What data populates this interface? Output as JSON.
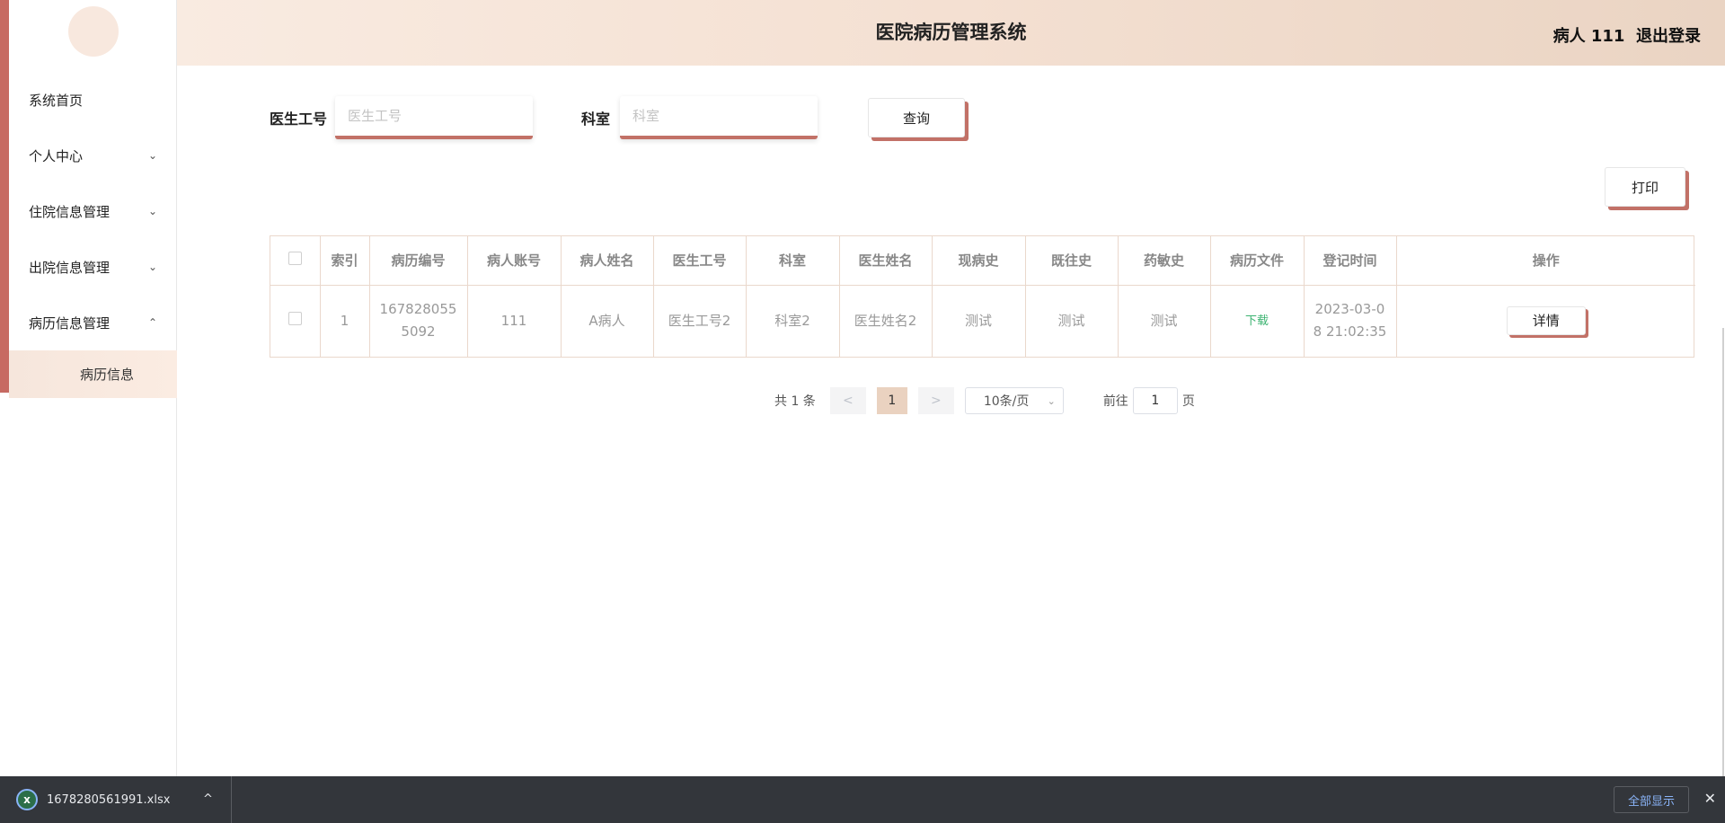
{
  "header": {
    "title": "医院病历管理系统",
    "user_name": "病人 111",
    "logout_label": "退出登录"
  },
  "sidebar": {
    "items": [
      {
        "label": "系统首页",
        "has_chevron": false
      },
      {
        "label": "个人中心",
        "chevron": "⌄"
      },
      {
        "label": "住院信息管理",
        "chevron": "⌄"
      },
      {
        "label": "出院信息管理",
        "chevron": "⌄"
      },
      {
        "label": "病历信息管理",
        "chevron": "⌃"
      }
    ],
    "submenu_label": "病历信息"
  },
  "search": {
    "doctor_id_label": "医生工号",
    "doctor_id_placeholder": "医生工号",
    "department_label": "科室",
    "department_placeholder": "科室",
    "query_label": "查询"
  },
  "toolbar": {
    "print_label": "打印"
  },
  "table": {
    "columns": [
      "索引",
      "病历编号",
      "病人账号",
      "病人姓名",
      "医生工号",
      "科室",
      "医生姓名",
      "现病史",
      "既往史",
      "药敏史",
      "病历文件",
      "登记时间",
      "操作"
    ],
    "rows": [
      {
        "index": "1",
        "record_no_line1": "167828055",
        "record_no_line2": "5092",
        "patient_account": "111",
        "patient_name": "A病人",
        "doctor_id": "医生工号2",
        "department": "科室2",
        "doctor_name": "医生姓名2",
        "present_history": "测试",
        "past_history": "测试",
        "allergy_history": "测试",
        "file_link": "下载",
        "time_line1": "2023-03-0",
        "time_line2": "8 21:02:35",
        "action_label": "详情"
      }
    ]
  },
  "pagination": {
    "total_text": "共 1 条",
    "prev": "<",
    "current_page": "1",
    "next": ">",
    "page_size": "10条/页",
    "goto_label": "前往",
    "goto_value": "1",
    "page_suffix": "页"
  },
  "download_bar": {
    "file_name": "1678280561991.xlsx",
    "show_all_label": "全部显示",
    "close_glyph": "✕"
  },
  "colors": {
    "accent": "#c27167",
    "header_gradient_start": "#f9ebe1",
    "header_gradient_end": "#ead4c3",
    "active_page": "#ead2c0"
  }
}
